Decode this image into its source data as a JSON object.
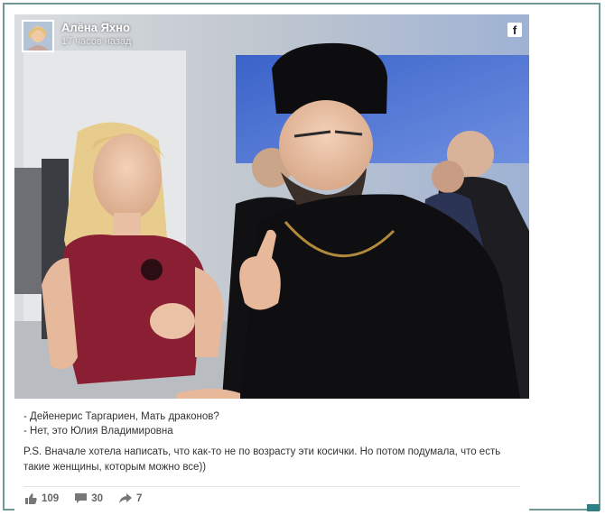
{
  "author": {
    "name": "Алёна Яхно",
    "time": "17 часов назад"
  },
  "network_icon": "facebook-icon",
  "caption": {
    "line1": "- Дейенерис Таргариен, Мать драконов?",
    "line2": "- Нет, это Юлия Владимировна",
    "ps": "P.S. Вначале хотела написать, что как-то не по возрасту эти косички. Но потом подумала, что есть такие женщины, которым можно все))"
  },
  "stats": {
    "likes": "109",
    "comments": "30",
    "shares": "7"
  },
  "colors": {
    "frame": "#6f9896",
    "accent": "#2e7e85",
    "text": "#333333",
    "meta": "#666666"
  }
}
